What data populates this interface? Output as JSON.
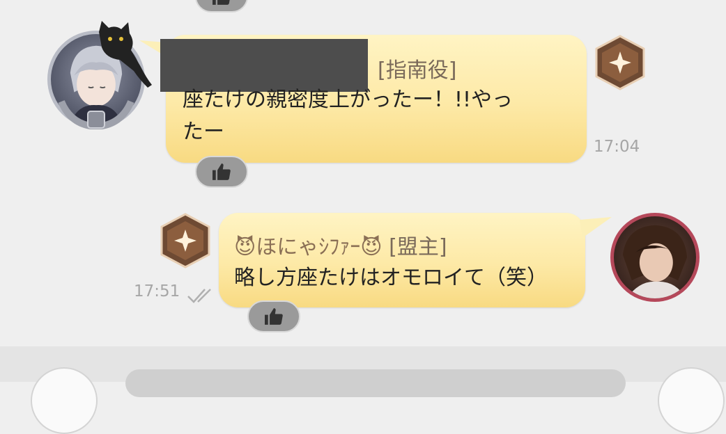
{
  "messages": [
    {
      "sender_role": "[指南役]",
      "text_line1": "座たけの親密度上がったー！!!やっ",
      "text_line2": "たー",
      "time": "17:04"
    },
    {
      "sender_emoji_left": "😈",
      "sender_name": "ほにゃｼﾌｧｰ",
      "sender_emoji_right": "😈",
      "sender_role": "[盟主]",
      "text": "略し方座たけはオモロイて（笑）",
      "time": "17:51",
      "read_status": "read"
    }
  ],
  "icons": {
    "like": "thumbs-up-icon",
    "rank": "rank-badge-icon",
    "read": "double-check-icon"
  },
  "colors": {
    "bubble": "#fde9a6",
    "role_text": "#8a6f55",
    "like_button": "#9a9a9a"
  }
}
